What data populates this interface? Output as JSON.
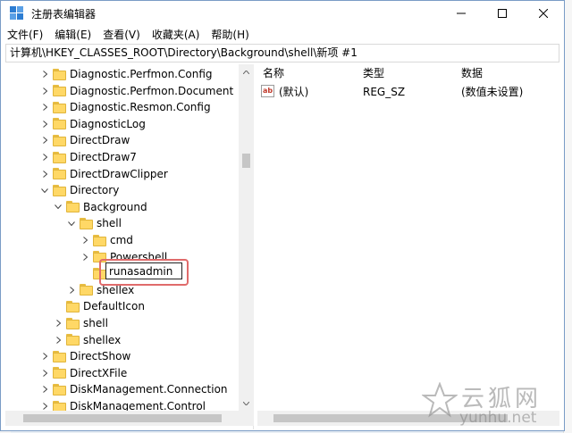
{
  "window": {
    "title": "注册表编辑器"
  },
  "menu": [
    "文件(F)",
    "编辑(E)",
    "查看(V)",
    "收藏夹(A)",
    "帮助(H)"
  ],
  "address": "计算机\\HKEY_CLASSES_ROOT\\Directory\\Background\\shell\\新项 #1",
  "tree": [
    {
      "label": "Diagnostic.Perfmon.Config",
      "level": 0,
      "expander": "collapsed"
    },
    {
      "label": "Diagnostic.Perfmon.Document",
      "level": 0,
      "expander": "collapsed"
    },
    {
      "label": "Diagnostic.Resmon.Config",
      "level": 0,
      "expander": "collapsed"
    },
    {
      "label": "DiagnosticLog",
      "level": 0,
      "expander": "collapsed"
    },
    {
      "label": "DirectDraw",
      "level": 0,
      "expander": "collapsed"
    },
    {
      "label": "DirectDraw7",
      "level": 0,
      "expander": "collapsed"
    },
    {
      "label": "DirectDrawClipper",
      "level": 0,
      "expander": "collapsed"
    },
    {
      "label": "Directory",
      "level": 0,
      "expander": "expanded"
    },
    {
      "label": "Background",
      "level": 1,
      "expander": "expanded"
    },
    {
      "label": "shell",
      "level": 2,
      "expander": "expanded"
    },
    {
      "label": "cmd",
      "level": 3,
      "expander": "collapsed"
    },
    {
      "label": "Powershell",
      "level": 3,
      "expander": "collapsed"
    },
    {
      "label": "",
      "level": 3,
      "expander": "none",
      "editing": true
    },
    {
      "label": "shellex",
      "level": 2,
      "expander": "collapsed"
    },
    {
      "label": "DefaultIcon",
      "level": 1,
      "expander": "none"
    },
    {
      "label": "shell",
      "level": 1,
      "expander": "collapsed"
    },
    {
      "label": "shellex",
      "level": 1,
      "expander": "collapsed"
    },
    {
      "label": "DirectShow",
      "level": 0,
      "expander": "collapsed"
    },
    {
      "label": "DirectXFile",
      "level": 0,
      "expander": "collapsed"
    },
    {
      "label": "DiskManagement.Connection",
      "level": 0,
      "expander": "collapsed"
    },
    {
      "label": "DiskManagement.Control",
      "level": 0,
      "expander": "collapsed"
    }
  ],
  "rename": {
    "value": "runasadmin"
  },
  "columns": {
    "name": "名称",
    "type": "类型",
    "data": "数据"
  },
  "values": [
    {
      "icon": "ab",
      "name": "(默认)",
      "type": "REG_SZ",
      "data": "(数值未设置)"
    }
  ],
  "watermark": {
    "cn": "云狐网",
    "en": "yunhu.net"
  },
  "colors": {
    "folder": "#ffd866",
    "highlight_outline": "#e06b6b",
    "accent": "#2d7dd2"
  }
}
